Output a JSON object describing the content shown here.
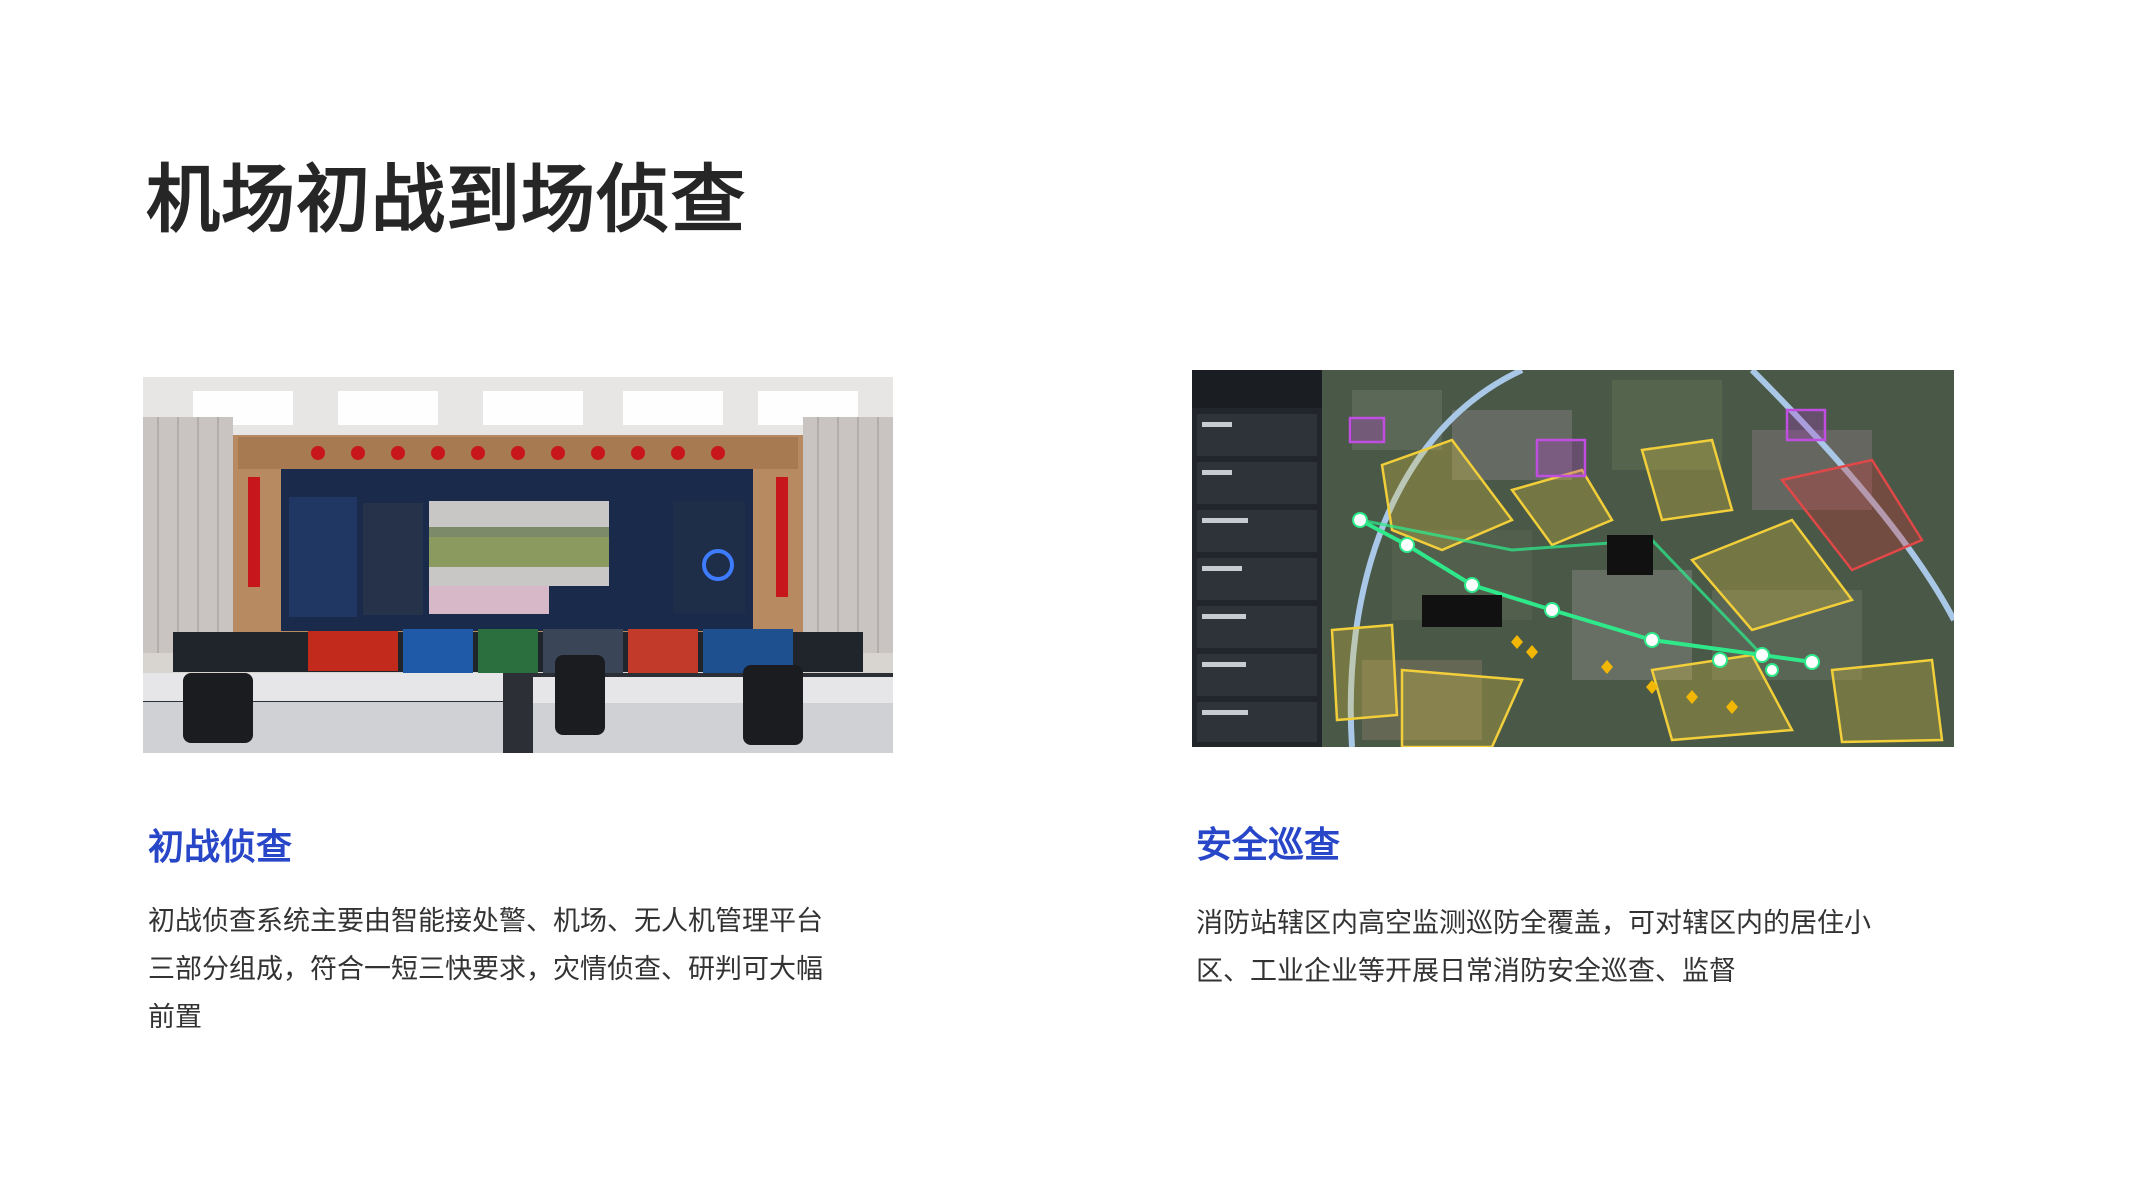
{
  "page": {
    "title": "机场初战到场侦查"
  },
  "left_card": {
    "image_icon": "command-center-photo",
    "heading": "初战侦查",
    "body_lines": [
      "初战侦查系统主要由智能接处警、机场、无人机管理平台",
      "三部分组成，符合一短三快要求，灾情侦查、研判可大幅",
      "前置"
    ]
  },
  "right_card": {
    "image_icon": "patrol-map-screenshot",
    "heading": "安全巡查",
    "body_lines": [
      "消防站辖区内高空监测巡防全覆盖，可对辖区内的居住小",
      "区、工业企业等开展日常消防安全巡查、监督"
    ]
  },
  "colors": {
    "heading": "#2846c8",
    "title": "#262626",
    "body": "#333333",
    "route": "#2ee88a"
  }
}
